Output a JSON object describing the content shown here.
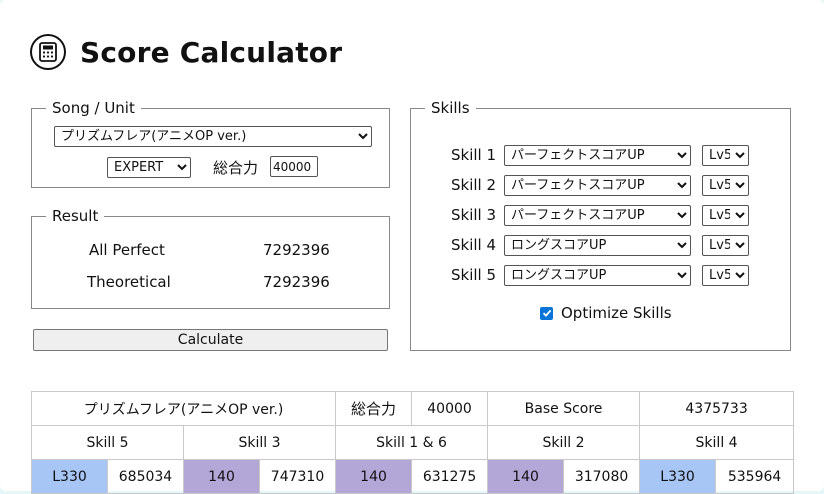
{
  "app": {
    "title": "Score Calculator",
    "logo_icon": "calculator-icon"
  },
  "song_unit": {
    "legend": "Song / Unit",
    "song_selected": "プリズムフレア(アニメOP ver.)",
    "difficulty_selected": "EXPERT",
    "power_label": "総合力",
    "power_value": "40000"
  },
  "result": {
    "legend": "Result",
    "rows": [
      {
        "label": "All Perfect",
        "value": "7292396"
      },
      {
        "label": "Theoretical",
        "value": "7292396"
      }
    ]
  },
  "calculate_label": "Calculate",
  "skills": {
    "legend": "Skills",
    "rows": [
      {
        "label": "Skill 1",
        "skill": "パーフェクトスコアUP",
        "level": "Lv5"
      },
      {
        "label": "Skill 2",
        "skill": "パーフェクトスコアUP",
        "level": "Lv5"
      },
      {
        "label": "Skill 3",
        "skill": "パーフェクトスコアUP",
        "level": "Lv5"
      },
      {
        "label": "Skill 4",
        "skill": "ロングスコアUP",
        "level": "Lv5"
      },
      {
        "label": "Skill 5",
        "skill": "ロングスコアUP",
        "level": "Lv5"
      }
    ],
    "optimize_label": "Optimize Skills",
    "optimize_checked": true
  },
  "summary_table": {
    "song": "プリズムフレア(アニメOP ver.)",
    "power_label": "総合力",
    "power_value": "40000",
    "base_label": "Base Score",
    "base_value": "4375733",
    "order": [
      {
        "name": "Skill 5",
        "tag": "L330",
        "tag_color": "#a7c5f5",
        "score": "685034"
      },
      {
        "name": "Skill 3",
        "tag": "140",
        "tag_color": "#b3a7d8",
        "score": "747310"
      },
      {
        "name": "Skill 1 & 6",
        "tag": "140",
        "tag_color": "#b3a7d8",
        "score": "631275"
      },
      {
        "name": "Skill 2",
        "tag": "140",
        "tag_color": "#b3a7d8",
        "score": "317080"
      },
      {
        "name": "Skill 4",
        "tag": "L330",
        "tag_color": "#a7c5f5",
        "score": "535964"
      }
    ]
  }
}
